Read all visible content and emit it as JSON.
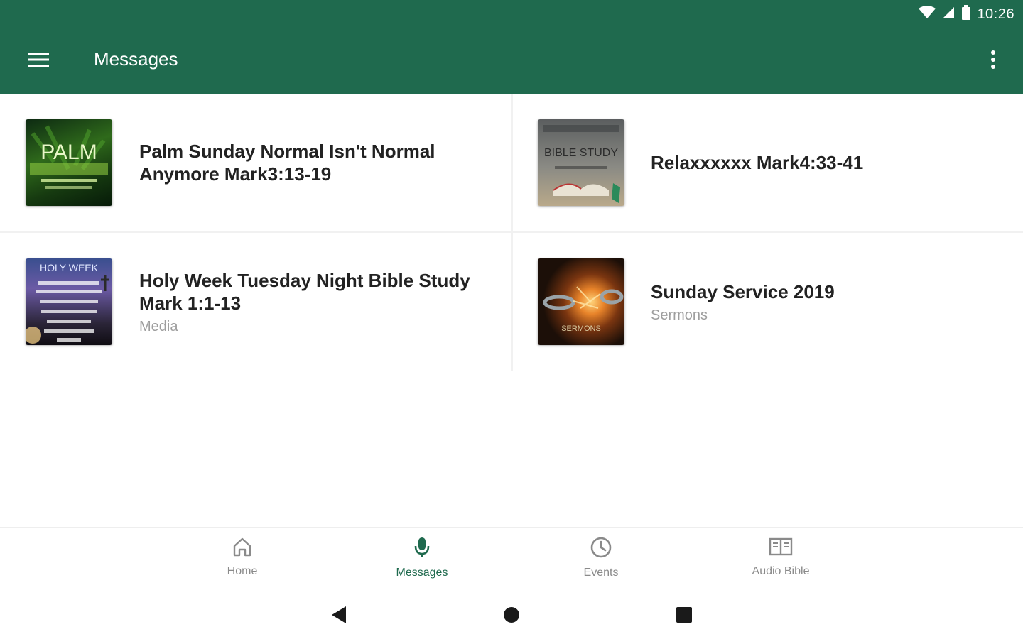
{
  "status_bar": {
    "time": "10:26"
  },
  "toolbar": {
    "title": "Messages"
  },
  "messages": [
    {
      "title": "Palm Sunday Normal Isn't Normal Anymore Mark3:13-19",
      "subtitle": "",
      "thumb_text": "PALM"
    },
    {
      "title": "Relaxxxxxx  Mark4:33-41",
      "subtitle": "",
      "thumb_text": "BIBLE STUDY"
    },
    {
      "title": "Holy Week Tuesday Night Bible Study Mark 1:1-13",
      "subtitle": "Media",
      "thumb_text": "HOLY WEEK"
    },
    {
      "title": "Sunday Service 2019",
      "subtitle": "Sermons",
      "thumb_text": "SERMONS"
    }
  ],
  "bottom_nav": {
    "items": [
      {
        "label": "Home",
        "icon": "home-icon"
      },
      {
        "label": "Messages",
        "icon": "microphone-icon"
      },
      {
        "label": "Events",
        "icon": "clock-icon"
      },
      {
        "label": "Audio Bible",
        "icon": "book-icon"
      }
    ],
    "active_index": 1
  },
  "colors": {
    "primary": "#1f6a4e",
    "inactive": "#8a8a8a"
  }
}
